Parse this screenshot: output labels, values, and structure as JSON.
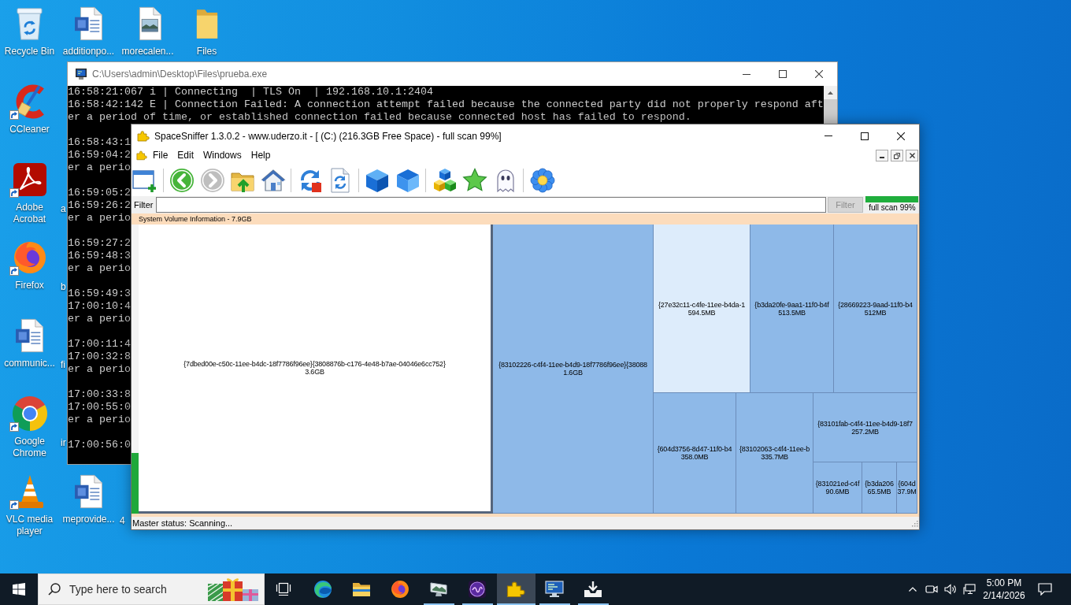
{
  "desktop": {
    "icons": [
      {
        "label": "Recycle Bin",
        "kind": "recycle-bin",
        "shortcut": false
      },
      {
        "label": "additionpo...",
        "kind": "word-document",
        "shortcut": false
      },
      {
        "label": "morecalen...",
        "kind": "image-document",
        "shortcut": false
      },
      {
        "label": "Files",
        "kind": "folder",
        "shortcut": false
      },
      {
        "label": "CCleaner",
        "kind": "ccleaner",
        "shortcut": true
      },
      {
        "label": "Adobe Acrobat",
        "kind": "acrobat",
        "shortcut": true
      },
      {
        "label": "a",
        "kind": "covered"
      },
      {
        "label": "Firefox",
        "kind": "firefox",
        "shortcut": true
      },
      {
        "label": "b",
        "kind": "covered"
      },
      {
        "label": "communic...",
        "kind": "word-document",
        "shortcut": false
      },
      {
        "label": "fi",
        "kind": "covered"
      },
      {
        "label": "Google Chrome",
        "kind": "chrome",
        "shortcut": true
      },
      {
        "label": "ir",
        "kind": "covered"
      },
      {
        "label": "VLC media player",
        "kind": "vlc",
        "shortcut": true
      },
      {
        "label": "meprovide...",
        "kind": "word-document",
        "shortcut": false
      },
      {
        "label": "4",
        "kind": "covered"
      }
    ]
  },
  "console_window": {
    "title": "C:\\Users\\admin\\Desktop\\Files\\prueba.exe",
    "output": [
      [
        "16:58:21:067 i | Connecting  | TLS On  | 192.168.10.1:2404",
        "16:58:42:142 E | Connection Failed: A connection attempt failed because the connected party did not properly respond aft",
        "er a period of time, or established connection failed because connected host has failed to respond."
      ],
      [
        "16:58:43:1",
        "16:59:04:2",
        "er a perio"
      ],
      [
        "16:59:05:2",
        "16:59:26:2",
        "er a perio"
      ],
      [
        "16:59:27:2",
        "16:59:48:3",
        "er a perio"
      ],
      [
        "16:59:49:3",
        "17:00:10:4",
        "er a perio"
      ],
      [
        "17:00:11:4",
        "17:00:32:8",
        "er a perio"
      ],
      [
        "17:00:33:8",
        "17:00:55:0",
        "er a perio"
      ],
      [
        "17:00:56:0"
      ]
    ]
  },
  "spacesniffer_window": {
    "title": "SpaceSniffer 1.3.0.2 - www.uderzo.it - [ (C:) (216.3GB Free Space) - full scan 99%]",
    "menu": [
      "File",
      "Edit",
      "Windows",
      "Help"
    ],
    "toolbar": [
      [
        {
          "kind": "new-window",
          "disabled": false
        }
      ],
      [
        {
          "kind": "back",
          "disabled": false
        },
        {
          "kind": "forward",
          "disabled": true
        },
        {
          "kind": "folder-up",
          "disabled": false
        },
        {
          "kind": "home",
          "disabled": false
        }
      ],
      [
        {
          "kind": "refresh",
          "disabled": false
        },
        {
          "kind": "page-refresh",
          "disabled": false
        }
      ],
      [
        {
          "kind": "cube",
          "disabled": false
        },
        {
          "kind": "shaded-cube",
          "disabled": false
        }
      ],
      [
        {
          "kind": "cubes",
          "disabled": false
        },
        {
          "kind": "star",
          "disabled": false
        },
        {
          "kind": "ghost",
          "disabled": false
        }
      ],
      [
        {
          "kind": "flower",
          "disabled": false
        }
      ]
    ],
    "filter": {
      "label": "Filter",
      "button": {
        "label": "Filter",
        "disabled": true
      }
    },
    "scan_progress": {
      "level": 0.99,
      "label": "full scan 99%"
    },
    "treemap": {
      "header": "System Volume Information - 7.9GB",
      "side_meter": {
        "level": 0.21
      },
      "cells": [
        {
          "name": "{7dbed00e-c50c-11ee-b4dc-18f7786f96ee}{3808876b-c176-4e48-b7ae-04046e6cc752}",
          "size": "3.6GB",
          "color": "#ffffff",
          "hovered": true
        },
        {
          "name": "{83102226-c4f4-11ee-b4d9-18f7786f96ee}{38088",
          "size": "1.6GB",
          "color": "#8eb9e8",
          "hovered": false
        },
        {
          "name": "{27e32c11-c4fe-11ee-b4da-1",
          "size": "594.5MB",
          "color": "#ddecfb",
          "hovered": false
        },
        {
          "name": "{b3da20fe-9aa1-11f0-b4f",
          "size": "513.5MB",
          "color": "#8eb9e8",
          "hovered": false
        },
        {
          "name": "{28669223-9aad-11f0-b4",
          "size": "512MB",
          "color": "#8eb9e8",
          "hovered": false
        },
        {
          "name": "{604d3756-8d47-11f0-b4",
          "size": "358.0MB",
          "color": "#8eb9e8",
          "hovered": false
        },
        {
          "name": "{83102063-c4f4-11ee-b",
          "size": "335.7MB",
          "color": "#8eb9e8",
          "hovered": false
        },
        {
          "name": "{83101fab-c4f4-11ee-b4d9-18f7",
          "size": "257.2MB",
          "color": "#8eb9e8",
          "hovered": false
        },
        {
          "name": "{831021ed-c4f",
          "size": "90.6MB",
          "color": "#8eb9e8",
          "hovered": false
        },
        {
          "name": "{b3da206",
          "size": "65.5MB",
          "color": "#8eb9e8",
          "hovered": false
        },
        {
          "name": "{604d",
          "size": "37.9M",
          "color": "#8eb9e8",
          "hovered": false
        }
      ]
    },
    "status_bar": "Master status: Scanning..."
  },
  "taskbar": {
    "search": {
      "placeholder": "Type here to search"
    },
    "apps": [
      {
        "kind": "task-view",
        "running": false,
        "selected": false
      },
      {
        "kind": "edge",
        "running": false,
        "selected": false
      },
      {
        "kind": "explorer",
        "running": false,
        "selected": false
      },
      {
        "kind": "firefox",
        "running": false,
        "selected": false
      },
      {
        "kind": "monitors",
        "running": true,
        "selected": false
      },
      {
        "kind": "orb",
        "running": true,
        "selected": false
      },
      {
        "kind": "puzzle",
        "running": true,
        "selected": true
      },
      {
        "kind": "terminal",
        "running": true,
        "selected": false
      },
      {
        "kind": "installer",
        "running": true,
        "selected": false
      }
    ],
    "clock": {
      "time": "5:00 PM",
      "date": "2/14/2026"
    }
  }
}
